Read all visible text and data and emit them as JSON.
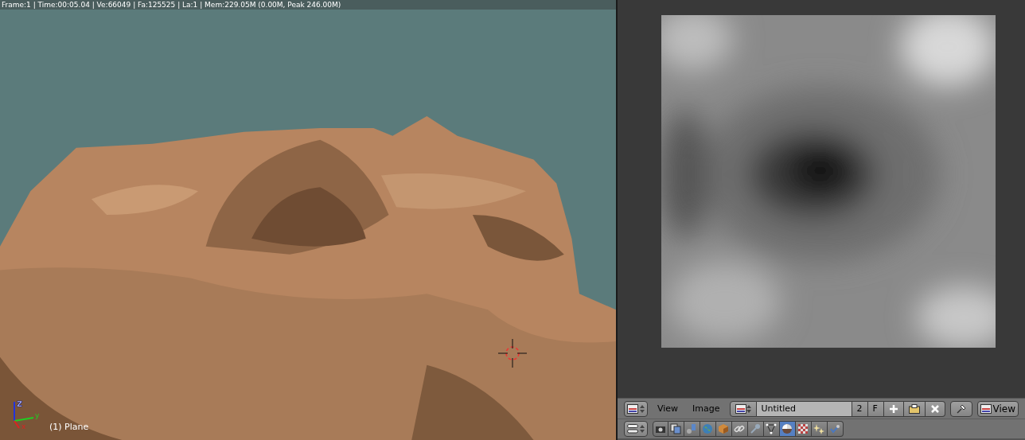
{
  "viewport": {
    "info": "Frame:1 | Time:00:05.04 | Ve:66049 | Fa:125525 | La:1 | Mem:229.05M (0.00M, Peak 246.00M)",
    "object_label": "(1) Plane",
    "axes": {
      "x": "x",
      "y": "y",
      "z": "z"
    }
  },
  "image_editor": {
    "header": {
      "menus": [
        "View",
        "Image"
      ],
      "image_name": "Untitled",
      "users": "2",
      "fake_user": "F",
      "view_mode": "View"
    }
  },
  "properties": {
    "tabs": [
      {
        "selected": false
      },
      {
        "selected": false
      },
      {
        "selected": false
      },
      {
        "selected": false
      },
      {
        "selected": false
      },
      {
        "selected": false
      },
      {
        "selected": false
      },
      {
        "selected": false
      },
      {
        "selected": true
      },
      {
        "selected": false
      },
      {
        "selected": false
      },
      {
        "selected": false
      }
    ]
  }
}
